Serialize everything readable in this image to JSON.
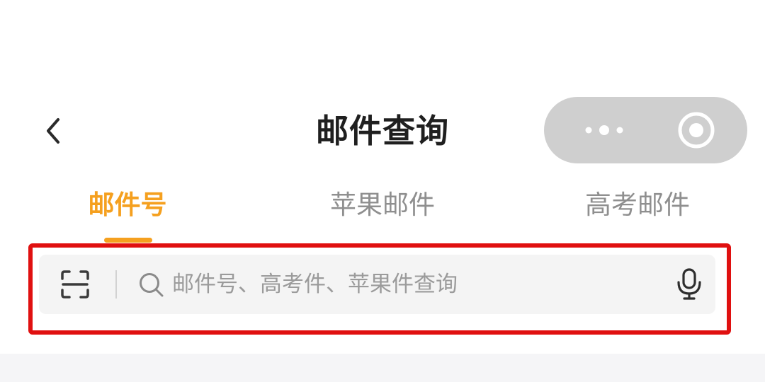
{
  "header": {
    "title": "邮件查询",
    "back_icon": "chevron-left-icon",
    "capsule": {
      "more_icon": "more-dots-icon",
      "close_icon": "target-circle-icon"
    }
  },
  "tabs": [
    {
      "label": "邮件号",
      "active": true
    },
    {
      "label": "苹果邮件",
      "active": false
    },
    {
      "label": "高考邮件",
      "active": false
    }
  ],
  "search": {
    "placeholder": "邮件号、高考件、苹果件查询",
    "value": "",
    "scan_icon": "scan-icon",
    "search_icon": "search-icon",
    "mic_icon": "microphone-icon"
  },
  "colors": {
    "accent": "#f5a01f",
    "highlight": "#e01010",
    "capsule_bg": "#cfcfcf"
  }
}
